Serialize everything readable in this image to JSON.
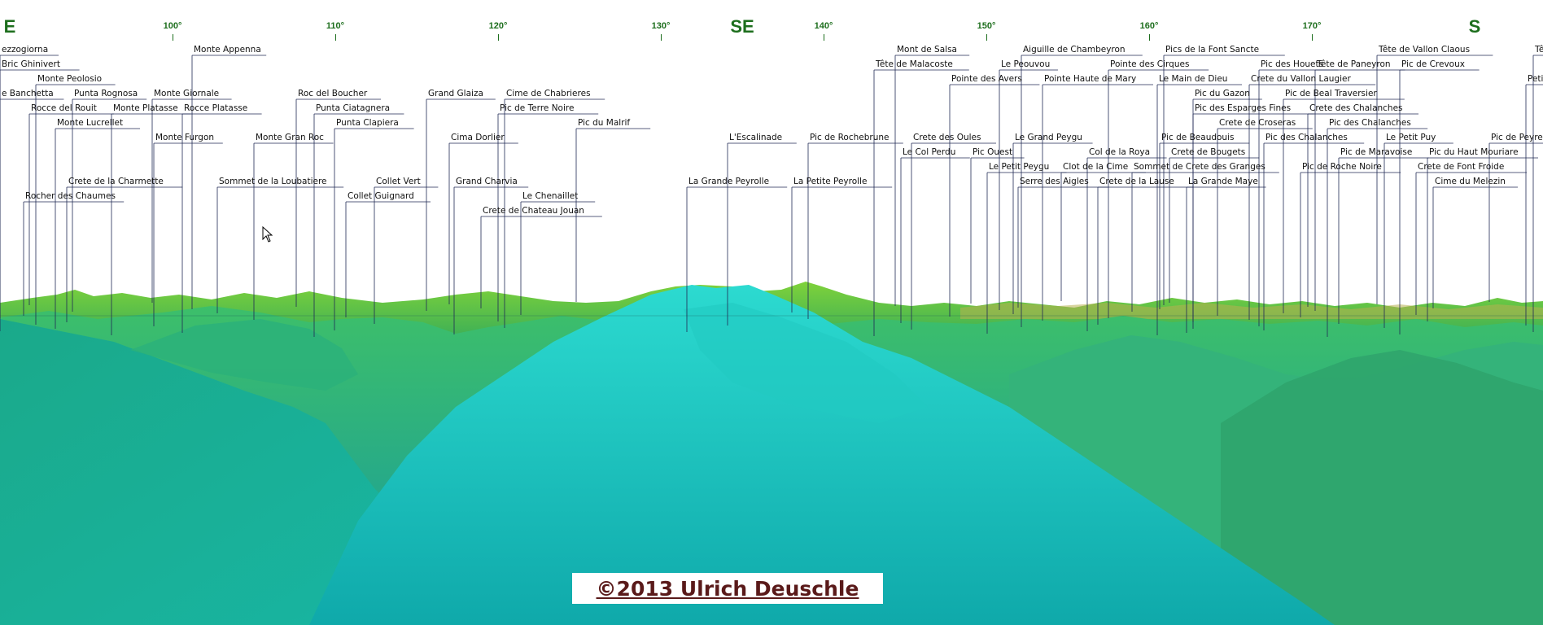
{
  "panorama": {
    "compass_labels": [
      {
        "text": "E",
        "deg": 90
      },
      {
        "text": "SE",
        "deg": 135
      },
      {
        "text": "S",
        "deg": 180
      }
    ],
    "degree_ticks": [
      {
        "text": "100°",
        "deg": 100
      },
      {
        "text": "110°",
        "deg": 110
      },
      {
        "text": "120°",
        "deg": 120
      },
      {
        "text": "130°",
        "deg": 130
      },
      {
        "text": "140°",
        "deg": 140
      },
      {
        "text": "150°",
        "deg": 150
      },
      {
        "text": "160°",
        "deg": 160
      },
      {
        "text": "170°",
        "deg": 170
      }
    ],
    "peaks": [
      {
        "name": "ezzogiorna",
        "row": 0
      },
      {
        "name": "Bric Ghinivert",
        "row": 1
      },
      {
        "name": "Monte Peolosio",
        "row": 2
      },
      {
        "name": "e Banchetta",
        "row": 3
      },
      {
        "name": "Punta Rognosa",
        "row": 3
      },
      {
        "name": "Rocce del Rouit",
        "row": 4
      },
      {
        "name": "Monte Platasse",
        "row": 4
      },
      {
        "name": "Monte Lucrellet",
        "row": 5
      },
      {
        "name": "Crete de la Charmette",
        "row": 9
      },
      {
        "name": "Rocher des Chaumes",
        "row": 10
      },
      {
        "name": "Monte Appenna",
        "row": 0
      },
      {
        "name": "Monte Giornale",
        "row": 3
      },
      {
        "name": "Rocce Platasse",
        "row": 4
      },
      {
        "name": "Monte Furgon",
        "row": 6
      },
      {
        "name": "Monte Gran Roc",
        "row": 6
      },
      {
        "name": "Sommet de la Loubatiere",
        "row": 9
      },
      {
        "name": "Roc del Boucher",
        "row": 3
      },
      {
        "name": "Punta Ciatagnera",
        "row": 4
      },
      {
        "name": "Punta Clapiera",
        "row": 5
      },
      {
        "name": "Collet Vert",
        "row": 9
      },
      {
        "name": "Collet Guignard",
        "row": 10
      },
      {
        "name": "Grand Glaiza",
        "row": 3
      },
      {
        "name": "Cima Dorlier",
        "row": 6
      },
      {
        "name": "Grand Charvia",
        "row": 9
      },
      {
        "name": "Cime de Chabrieres",
        "row": 3
      },
      {
        "name": "Pic de Terre Noire",
        "row": 4
      },
      {
        "name": "Le Chenaillet",
        "row": 10
      },
      {
        "name": "Crete de Chateau Jouan",
        "row": 11
      },
      {
        "name": "Pic du Malrif",
        "row": 5
      },
      {
        "name": "La Grande Peyrolle",
        "row": 9
      },
      {
        "name": "L'Escalinade",
        "row": 6
      },
      {
        "name": "Pic de Rochebrune",
        "row": 6
      },
      {
        "name": "La Petite Peyrolle",
        "row": 9
      },
      {
        "name": "Mont de Salsa",
        "row": 0
      },
      {
        "name": "Tête de Malacoste",
        "row": 1
      },
      {
        "name": "Crete des Oules",
        "row": 6
      },
      {
        "name": "Le Col Perdu",
        "row": 7
      },
      {
        "name": "Pointe des Avers",
        "row": 2
      },
      {
        "name": "Le Peouvou",
        "row": 1
      },
      {
        "name": "Pic Ouest",
        "row": 7
      },
      {
        "name": "Le Petit Peygu",
        "row": 8
      },
      {
        "name": "Aiguille de Chambeyron",
        "row": 0
      },
      {
        "name": "Pointe Haute de Mary",
        "row": 2
      },
      {
        "name": "Le Grand Peygu",
        "row": 6
      },
      {
        "name": "Serre des Aigles",
        "row": 9
      },
      {
        "name": "Clot de la Cime",
        "row": 8
      },
      {
        "name": "Col de la Roya",
        "row": 7
      },
      {
        "name": "Crete de la Lause",
        "row": 9
      },
      {
        "name": "Pointe des Cirques",
        "row": 1
      },
      {
        "name": "Sommet de Crete des Granges",
        "row": 8
      },
      {
        "name": "Pics de la Font Sancte",
        "row": 0
      },
      {
        "name": "Le Main de Dieu",
        "row": 2
      },
      {
        "name": "Pic du Gazon",
        "row": 3
      },
      {
        "name": "Pic des Esparges Fines",
        "row": 4
      },
      {
        "name": "Crete de Croseras",
        "row": 5
      },
      {
        "name": "Pic de Beaudouis",
        "row": 6
      },
      {
        "name": "Crete de Bougets",
        "row": 7
      },
      {
        "name": "La Grande Maye",
        "row": 9
      },
      {
        "name": "Pic des Houets",
        "row": 1
      },
      {
        "name": "Crete du Vallon Laugier",
        "row": 2
      },
      {
        "name": "Pic de Beal Traversier",
        "row": 3
      },
      {
        "name": "Crete des Chalanches",
        "row": 4
      },
      {
        "name": "Pic des Chalanches",
        "row": 5
      },
      {
        "name": "Pic des Chalanches",
        "row": 6
      },
      {
        "name": "Pic de Maravoise",
        "row": 7
      },
      {
        "name": "Pic de Roche Noire",
        "row": 8
      },
      {
        "name": "Tête de Paneyron",
        "row": 1
      },
      {
        "name": "Tête de Vallon Claous",
        "row": 0
      },
      {
        "name": "Pic de Crevoux",
        "row": 1
      },
      {
        "name": "Le Petit Puy",
        "row": 6
      },
      {
        "name": "Pic du Haut Mouriare",
        "row": 7
      },
      {
        "name": "Crete de Font Froide",
        "row": 8
      },
      {
        "name": "Cime du Melezin",
        "row": 9
      },
      {
        "name": "Pic de Peyre B",
        "row": 6
      },
      {
        "name": "Tê",
        "row": 0
      },
      {
        "name": "Peti",
        "row": 2
      }
    ],
    "copyright": "©2013 Ulrich Deuschle",
    "colors": {
      "label_line": "#202a55",
      "compass": "#1d6e1d",
      "near_terrain": "#1fc2b8",
      "mid_terrain": "#2fb080",
      "far_terrain": "#4fc83a",
      "horizon": "#9acc2e"
    }
  }
}
